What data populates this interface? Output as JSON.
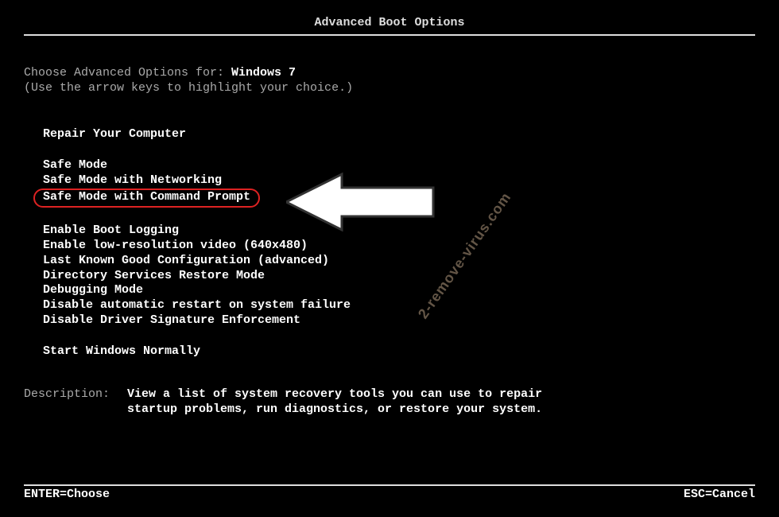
{
  "title": "Advanced Boot Options",
  "intro": {
    "prefix": "Choose Advanced Options for: ",
    "os": "Windows 7",
    "hint": "(Use the arrow keys to highlight your choice.)"
  },
  "groups": {
    "g1": [
      "Repair Your Computer"
    ],
    "g2": [
      "Safe Mode",
      "Safe Mode with Networking",
      "Safe Mode with Command Prompt"
    ],
    "g3": [
      "Enable Boot Logging",
      "Enable low-resolution video (640x480)",
      "Last Known Good Configuration (advanced)",
      "Directory Services Restore Mode",
      "Debugging Mode",
      "Disable automatic restart on system failure",
      "Disable Driver Signature Enforcement"
    ],
    "g4": [
      "Start Windows Normally"
    ]
  },
  "selected": "Safe Mode with Command Prompt",
  "description": {
    "label": "Description:",
    "text": "View a list of system recovery tools you can use to repair startup problems, run diagnostics, or restore your system."
  },
  "footer": {
    "left": "ENTER=Choose",
    "right": "ESC=Cancel"
  },
  "watermark": "2-remove-virus.com",
  "colors": {
    "highlight_border": "#d22",
    "text_dim": "#aaa",
    "text_bright": "#fff"
  }
}
